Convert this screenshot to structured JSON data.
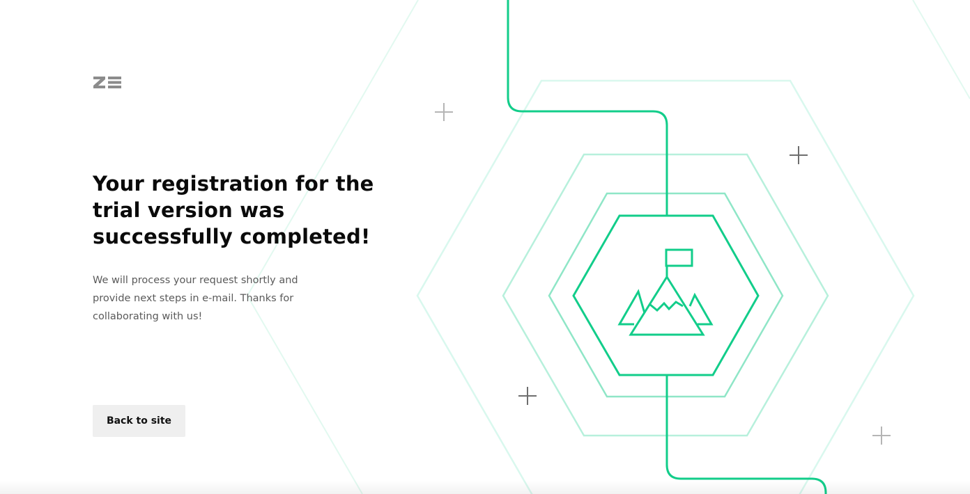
{
  "logo": {
    "icon": "ze-logo-icon",
    "color": "#8c8c8c"
  },
  "headline": "Your registration for the trial version was successfully completed!",
  "description": "We will process your request shortly and provide next steps in e-mail. Thanks for collaborating with us!",
  "back_button": {
    "label": "Back to site"
  },
  "illustration": {
    "icon": "mountain-flag-icon",
    "accent_color": "#12cd8a",
    "light_accent_color": "#d9f8ee",
    "plus_color": "#7a7a7a"
  }
}
